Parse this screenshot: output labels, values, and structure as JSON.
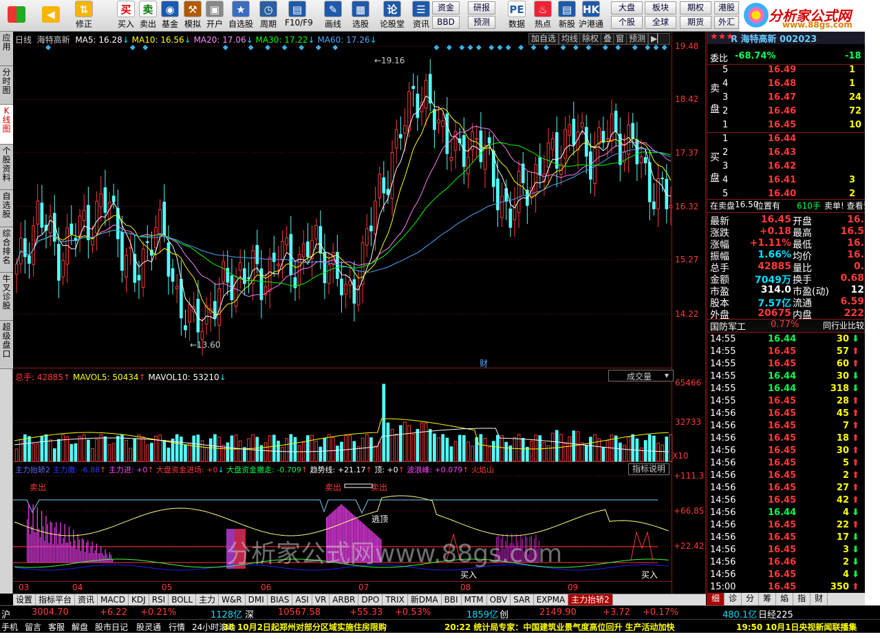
{
  "toolbar": {
    "items": [
      {
        "label": "修正",
        "icon": "up-down-arrows-icon"
      },
      {
        "label": "买入",
        "icon": "buy-icon",
        "glyph": "买"
      },
      {
        "label": "卖出",
        "icon": "sell-icon",
        "glyph": "卖"
      },
      {
        "label": "基金",
        "icon": "fund-icon"
      },
      {
        "label": "模拟",
        "icon": "hammer-icon"
      },
      {
        "label": "开户",
        "icon": "lock-icon"
      },
      {
        "label": "自选股",
        "icon": "star-folder-icon"
      },
      {
        "label": "周期",
        "icon": "clock-icon"
      },
      {
        "label": "F10/F9",
        "icon": "f10-icon"
      },
      {
        "label": "画线",
        "icon": "pen-icon"
      },
      {
        "label": "选股",
        "icon": "select-stock-icon"
      },
      {
        "label": "论股堂",
        "icon": "discussion-icon",
        "glyph": "论"
      },
      {
        "label": "资讯",
        "icon": "news-icon"
      },
      {
        "label": "数据",
        "icon": "pe-data-icon",
        "glyph": "PE"
      },
      {
        "label": "热点",
        "icon": "hot-icon"
      },
      {
        "label": "新股",
        "icon": "new-stock-icon"
      },
      {
        "label": "沪港通",
        "icon": "hk-connect-icon"
      }
    ],
    "small_buttons": [
      "资金",
      "BBD",
      "研报",
      "预测",
      "大盘",
      "个股",
      "板块",
      "全球",
      "期权",
      "期货",
      "港股",
      "外汇"
    ],
    "logo_title": "分析家公式网",
    "logo_url": "www.88gs.com"
  },
  "left_tabs": [
    "应用",
    "分时图",
    "K线图",
    "个股资料",
    "自选股",
    "综合排名",
    "牛叉诊股",
    "超级盘口"
  ],
  "chart_header": {
    "period": "日线",
    "name": "海特高新",
    "ma5": "MA5: 16.28",
    "ma10": "MA10: 16.56",
    "ma20": "MA20: 17.06",
    "ma30": "MA30: 17.22",
    "ma60": "MA60: 17.26",
    "buttons": [
      "加自选",
      "均线",
      "除权",
      "叠",
      "窗",
      "预测"
    ],
    "high_label": "19.16",
    "low_label": "13.60",
    "cai_marker": "财"
  },
  "price_axis": [
    "19.48",
    "18.42",
    "17.37",
    "16.32",
    "15.27",
    "14.22"
  ],
  "volume_header": {
    "total": "总手: 42885",
    "mavol5": "MAVOL5: 50434",
    "mavol10": "MAVOL10: 53210",
    "selector": "成交量"
  },
  "volume_axis": [
    "65466",
    "32733",
    "X10"
  ],
  "indicator_header": {
    "name": "主力抬轿2",
    "line1": "主力撤: -6.88",
    "line2": "主力进: +0",
    "line3": "大盘资金进场: +0",
    "line4": "大盘资金撤走: -0.709",
    "line5": "趋势线: +21.17",
    "line6": "顶: +0",
    "line7": "波浪峰: +0.079",
    "line8": "火焰山",
    "button": "指标说明"
  },
  "indicator_axis": [
    "+111.3",
    "+66.85",
    "+22.42"
  ],
  "indicator_marks": {
    "sell1": "卖出",
    "sell2": "卖出",
    "sell3": "卖出",
    "top": "逃顶",
    "buy1": "买入",
    "buy2": "买入",
    "watermark": "分析家公式网www.88gs.com"
  },
  "date_axis": [
    "03",
    "04",
    "05",
    "06",
    "07",
    "08",
    "09"
  ],
  "bottom_tabs": [
    "设置",
    "指标平台",
    "资讯",
    "MACD",
    "KDJ",
    "RSI",
    "BOLL",
    "主力",
    "W&R",
    "DMI",
    "BIAS",
    "ASI",
    "VR",
    "ARBR",
    "DPO",
    "TRIX",
    "新DMA",
    "BBI",
    "MTM",
    "OBV",
    "SAR",
    "EXPMA",
    "主力抬轿2"
  ],
  "quote": {
    "title": "R 海特高新 002023",
    "weibi_label": "委比",
    "weibi": "-68.74%",
    "weibi_right": "-18",
    "sell_side": "卖盘",
    "buy_side": "买盘",
    "sells": [
      {
        "n": "5",
        "p": "16.49",
        "v": "1"
      },
      {
        "n": "4",
        "p": "16.48",
        "v": "1"
      },
      {
        "n": "3",
        "p": "16.47",
        "v": "24"
      },
      {
        "n": "2",
        "p": "16.46",
        "v": "72"
      },
      {
        "n": "1",
        "p": "16.45",
        "v": "10"
      }
    ],
    "buys": [
      {
        "n": "1",
        "p": "16.44",
        "v": ""
      },
      {
        "n": "2",
        "p": "16.43",
        "v": ""
      },
      {
        "n": "3",
        "p": "16.42",
        "v": ""
      },
      {
        "n": "4",
        "p": "16.41",
        "v": "3"
      },
      {
        "n": "5",
        "p": "16.40",
        "v": "2"
      }
    ],
    "notice_a": "在卖盘",
    "notice_b": "16.50",
    "notice_c": "位置有",
    "notice_d": "610手",
    "notice_e": "卖单! 查看详",
    "stats": [
      {
        "l": "最新",
        "v": "16.45",
        "l2": "开盘",
        "v2": "16."
      },
      {
        "l": "涨跌",
        "v": "+0.18",
        "l2": "最高",
        "v2": "16.5"
      },
      {
        "l": "涨幅",
        "v": "+1.11%",
        "l2": "最低",
        "v2": "16."
      },
      {
        "l": "振幅",
        "v": "1.66%",
        "l2": "均价",
        "v2": "16."
      },
      {
        "l": "总手",
        "v": "42885",
        "l2": "量比",
        "v2": "0."
      },
      {
        "l": "金额",
        "v": "7049万",
        "l2": "换手",
        "v2": "0.68"
      },
      {
        "l": "市盈",
        "v": "314.0",
        "l2": "市盈(动)",
        "v2": "12"
      },
      {
        "l": "股本",
        "v": "7.57亿",
        "l2": "流通",
        "v2": "6.59"
      },
      {
        "l": "外盘",
        "v": "20675",
        "l2": "内盘",
        "v2": "222"
      }
    ],
    "sector": "国防军工",
    "sector_pct": "0.77%",
    "compare": "同行业比较",
    "ticks": [
      {
        "t": "14:55",
        "p": "16.44",
        "v": "30",
        "d": "down"
      },
      {
        "t": "14:55",
        "p": "16.45",
        "v": "57",
        "d": "up"
      },
      {
        "t": "14:55",
        "p": "16.45",
        "v": "60",
        "d": "up"
      },
      {
        "t": "14:55",
        "p": "16.44",
        "v": "30",
        "d": "down"
      },
      {
        "t": "14:55",
        "p": "16.44",
        "v": "318",
        "d": "down"
      },
      {
        "t": "14:55",
        "p": "16.45",
        "v": "28",
        "d": "up"
      },
      {
        "t": "14:56",
        "p": "16.45",
        "v": "45",
        "d": "up"
      },
      {
        "t": "14:56",
        "p": "16.45",
        "v": "7",
        "d": "up"
      },
      {
        "t": "14:56",
        "p": "16.45",
        "v": "18",
        "d": "up"
      },
      {
        "t": "14:56",
        "p": "16.45",
        "v": "30",
        "d": "up"
      },
      {
        "t": "14:56",
        "p": "16.45",
        "v": "5",
        "d": "up"
      },
      {
        "t": "14:56",
        "p": "16.45",
        "v": "2",
        "d": "up"
      },
      {
        "t": "14:56",
        "p": "16.45",
        "v": "27",
        "d": "up"
      },
      {
        "t": "14:56",
        "p": "16.45",
        "v": "42",
        "d": "up"
      },
      {
        "t": "14:56",
        "p": "16.44",
        "v": "4",
        "d": "down"
      },
      {
        "t": "14:56",
        "p": "16.45",
        "v": "22",
        "d": "up"
      },
      {
        "t": "14:56",
        "p": "16.45",
        "v": "17",
        "d": "down"
      },
      {
        "t": "14:56",
        "p": "16.45",
        "v": "3",
        "d": "down"
      },
      {
        "t": "14:56",
        "p": "16.46",
        "v": "2",
        "d": "down"
      },
      {
        "t": "14:56",
        "p": "16.45",
        "v": "4",
        "d": "down"
      },
      {
        "t": "15:00",
        "p": "16.45",
        "v": "350",
        "d": "up"
      }
    ],
    "tabs": [
      "细",
      "诊",
      "分",
      "筹",
      "焰",
      "指",
      "财"
    ]
  },
  "status": {
    "sh_label": "沪",
    "sh": "3004.70",
    "sh_chg": "+6.22",
    "sh_pct": "+0.21%",
    "sh_amt": "1128亿",
    "sz_label": "深",
    "sz": "10567.58",
    "sz_chg": "+55.33",
    "sz_pct": "+0.53%",
    "sz_amt": "1859亿",
    "cy_label": "创",
    "cy": "2149.90",
    "cy_chg": "+3.72",
    "cy_pct": "+0.17%",
    "cy_amt": "480.1亿",
    "rj_label": "日经225"
  },
  "status2": {
    "tabs": [
      "手机",
      "留言",
      "客服",
      "解盘",
      "股市日记",
      "股灵通",
      "行情",
      "24小时滚动"
    ],
    "news1": "38 10月2日起郑州对部分区域实施住房限购",
    "news2": "20:22 统计局专家：中国建筑业景气度高位回升 生产活动加快",
    "news3": "19:50 10月1日央视新闻联播集"
  },
  "colors": {
    "up": "#ff3a3a",
    "down": "#00e0ff",
    "ma5": "#ffffff",
    "ma10": "#ffff00",
    "ma20": "#ff80ff",
    "ma30": "#00ff00",
    "ma60": "#4fa8ff",
    "frame": "#8b1a1a"
  }
}
